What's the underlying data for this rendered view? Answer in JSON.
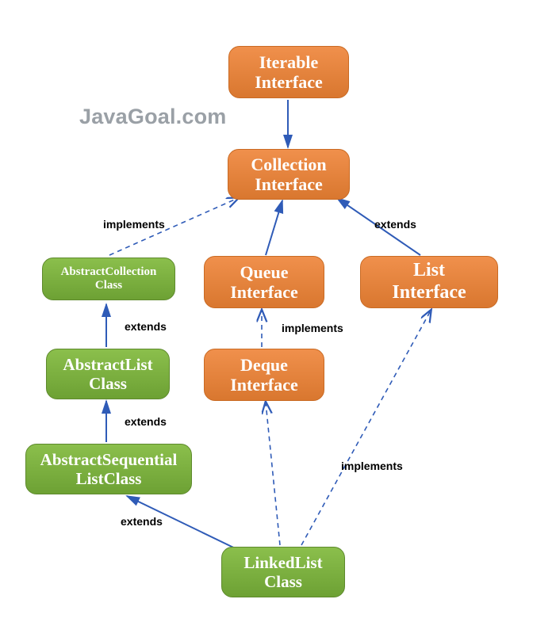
{
  "watermark": "JavaGoal.com",
  "nodes": {
    "iterable": {
      "line1": "Iterable",
      "line2": "Interface"
    },
    "collection": {
      "line1": "Collection",
      "line2": "Interface"
    },
    "abscoll": {
      "line1": "AbstractCollection",
      "line2": "Class"
    },
    "queue": {
      "line1": "Queue",
      "line2": "Interface"
    },
    "list": {
      "line1": "List",
      "line2": "Interface"
    },
    "abslist": {
      "line1": "AbstractList",
      "line2": "Class"
    },
    "deque": {
      "line1": "Deque",
      "line2": "Interface"
    },
    "absseq": {
      "line1": "AbstractSequential",
      "line2": "ListClass"
    },
    "linkedlist": {
      "line1": "LinkedList",
      "line2": "Class"
    }
  },
  "edgeLabels": {
    "implements1": "implements",
    "extends1": "extends",
    "extends2": "extends",
    "implements2": "implements",
    "extends3": "extends",
    "extends4": "extends",
    "implements3": "implements"
  },
  "colors": {
    "interfaceFill": "#e8833e",
    "classFill": "#7cb342",
    "connector": "#2f5bb7"
  },
  "chart_data": {
    "type": "diagram",
    "title": "Java LinkedList class hierarchy",
    "nodes": [
      {
        "id": "Iterable Interface",
        "kind": "interface"
      },
      {
        "id": "Collection Interface",
        "kind": "interface"
      },
      {
        "id": "AbstractCollection Class",
        "kind": "class"
      },
      {
        "id": "Queue Interface",
        "kind": "interface"
      },
      {
        "id": "List Interface",
        "kind": "interface"
      },
      {
        "id": "AbstractList Class",
        "kind": "class"
      },
      {
        "id": "Deque Interface",
        "kind": "interface"
      },
      {
        "id": "AbstractSequentialListClass",
        "kind": "class"
      },
      {
        "id": "LinkedList Class",
        "kind": "class"
      }
    ],
    "edges": [
      {
        "from": "Iterable Interface",
        "to": "Collection Interface",
        "relation": "extends",
        "style": "solid"
      },
      {
        "from": "AbstractCollection Class",
        "to": "Collection Interface",
        "relation": "implements",
        "style": "dashed"
      },
      {
        "from": "Queue Interface",
        "to": "Collection Interface",
        "relation": "extends",
        "style": "solid"
      },
      {
        "from": "List Interface",
        "to": "Collection Interface",
        "relation": "extends",
        "style": "solid"
      },
      {
        "from": "AbstractList Class",
        "to": "AbstractCollection Class",
        "relation": "extends",
        "style": "solid"
      },
      {
        "from": "Deque Interface",
        "to": "Queue Interface",
        "relation": "extends",
        "style": "dashed"
      },
      {
        "from": "AbstractSequentialListClass",
        "to": "AbstractList Class",
        "relation": "extends",
        "style": "solid"
      },
      {
        "from": "LinkedList Class",
        "to": "AbstractSequentialListClass",
        "relation": "extends",
        "style": "solid"
      },
      {
        "from": "LinkedList Class",
        "to": "Deque Interface",
        "relation": "implements",
        "style": "dashed"
      },
      {
        "from": "LinkedList Class",
        "to": "List Interface",
        "relation": "implements",
        "style": "dashed"
      }
    ]
  }
}
